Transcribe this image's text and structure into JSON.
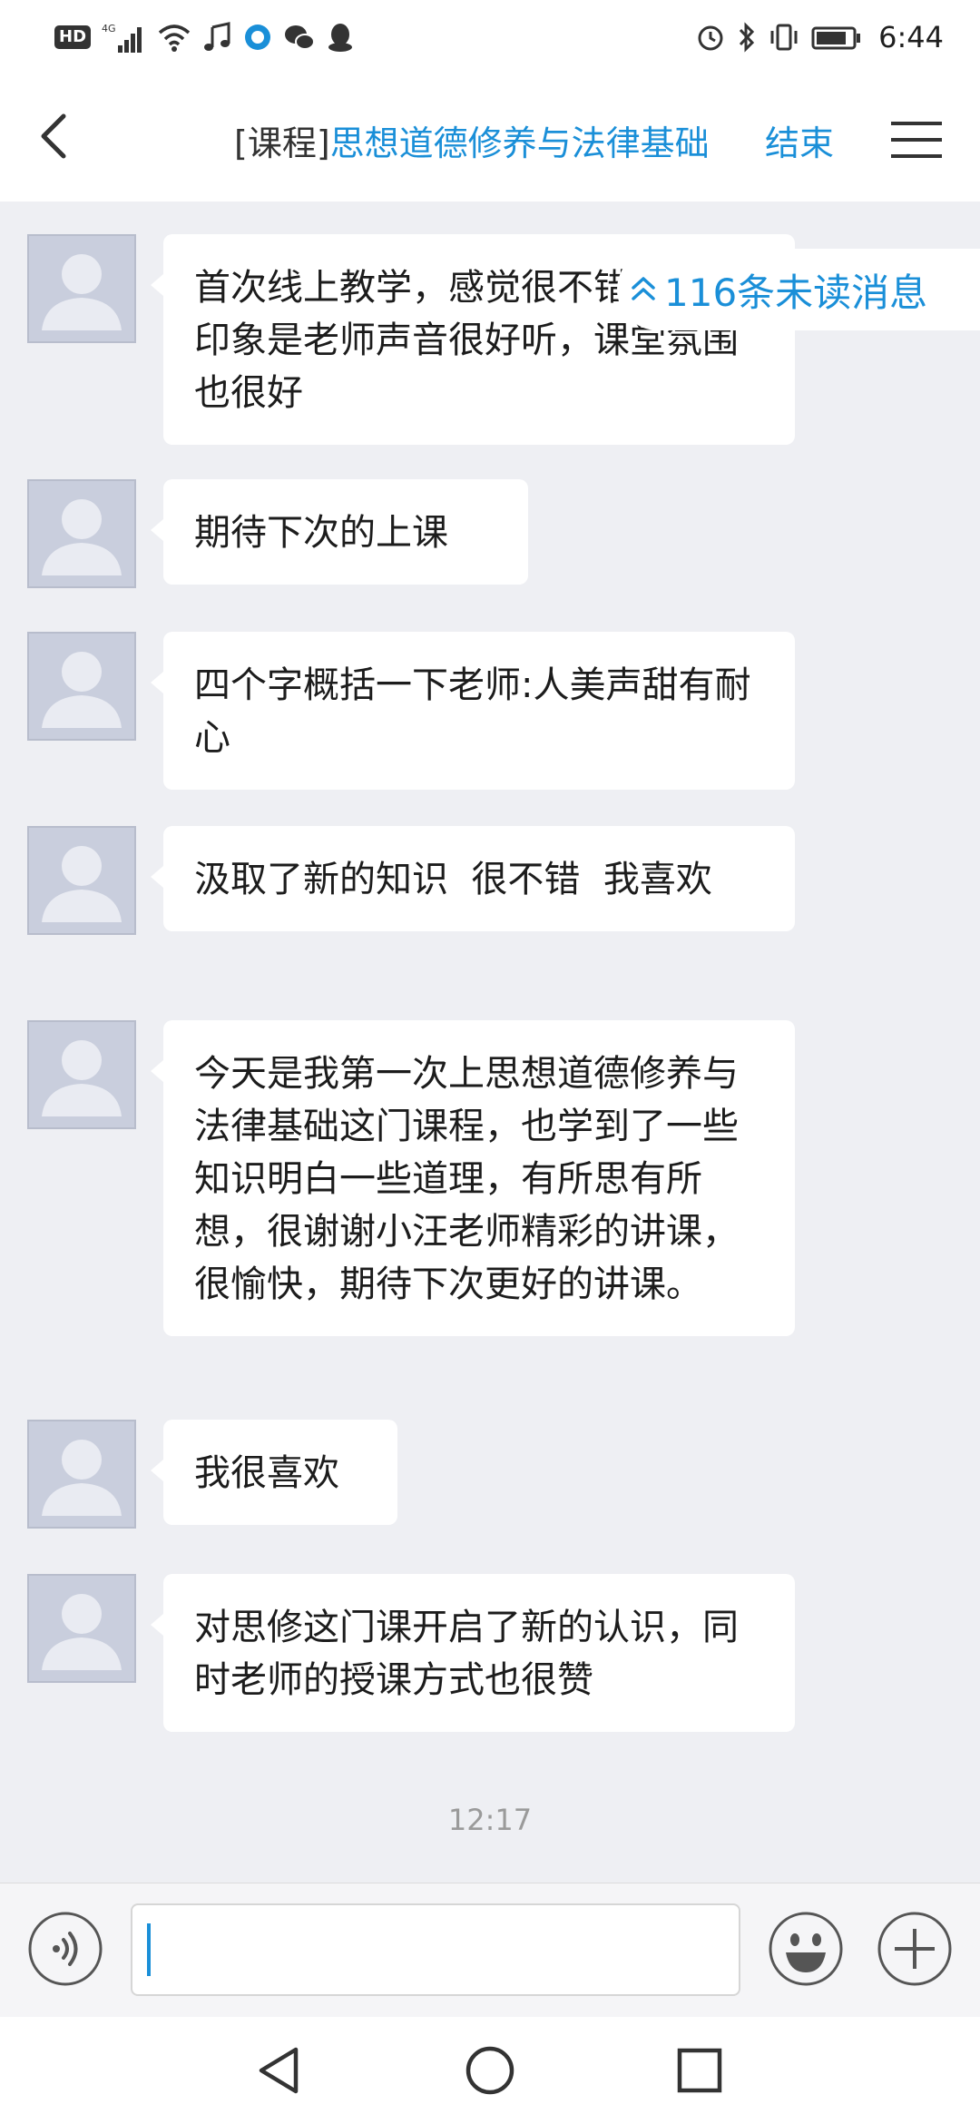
{
  "status_bar": {
    "time": "6:44",
    "hd": "HD",
    "network": "4G"
  },
  "header": {
    "title_prefix": "[课程]",
    "title_course": "思想道德修养与法律基础",
    "end_label": "结束",
    "back_icon": "chevron-left-icon",
    "menu_icon": "hamburger-menu-icon"
  },
  "unread_banner": {
    "text": "116条未读消息",
    "icon": "double-chevron-up-icon"
  },
  "messages": [
    {
      "text": "首次线上教学，感觉很不错，第一印象是老师声音很好听，课堂氛围也很好"
    },
    {
      "text": "期待下次的上课"
    },
    {
      "text": "四个字概括一下老师:人美声甜有耐心"
    },
    {
      "text": "汲取了新的知识  很不错  我喜欢"
    },
    {
      "text": "今天是我第一次上思想道德修养与法律基础这门课程，也学到了一些知识明白一些道理，有所思有所想，很谢谢小汪老师精彩的讲课，很愉快，期待下次更好的讲课。"
    },
    {
      "text": "我很喜欢"
    },
    {
      "text": "对思修这门课开启了新的认识，同时老师的授课方式也很赞"
    }
  ],
  "timestamp": "12:17",
  "input_bar": {
    "value": "",
    "voice_icon": "voice-icon",
    "emoji_icon": "emoji-icon",
    "plus_icon": "plus-icon"
  },
  "colors": {
    "accent": "#1a8fd8",
    "chat_background": "#eeeff3",
    "bubble": "#ffffff",
    "avatar": "#c9cedd"
  }
}
